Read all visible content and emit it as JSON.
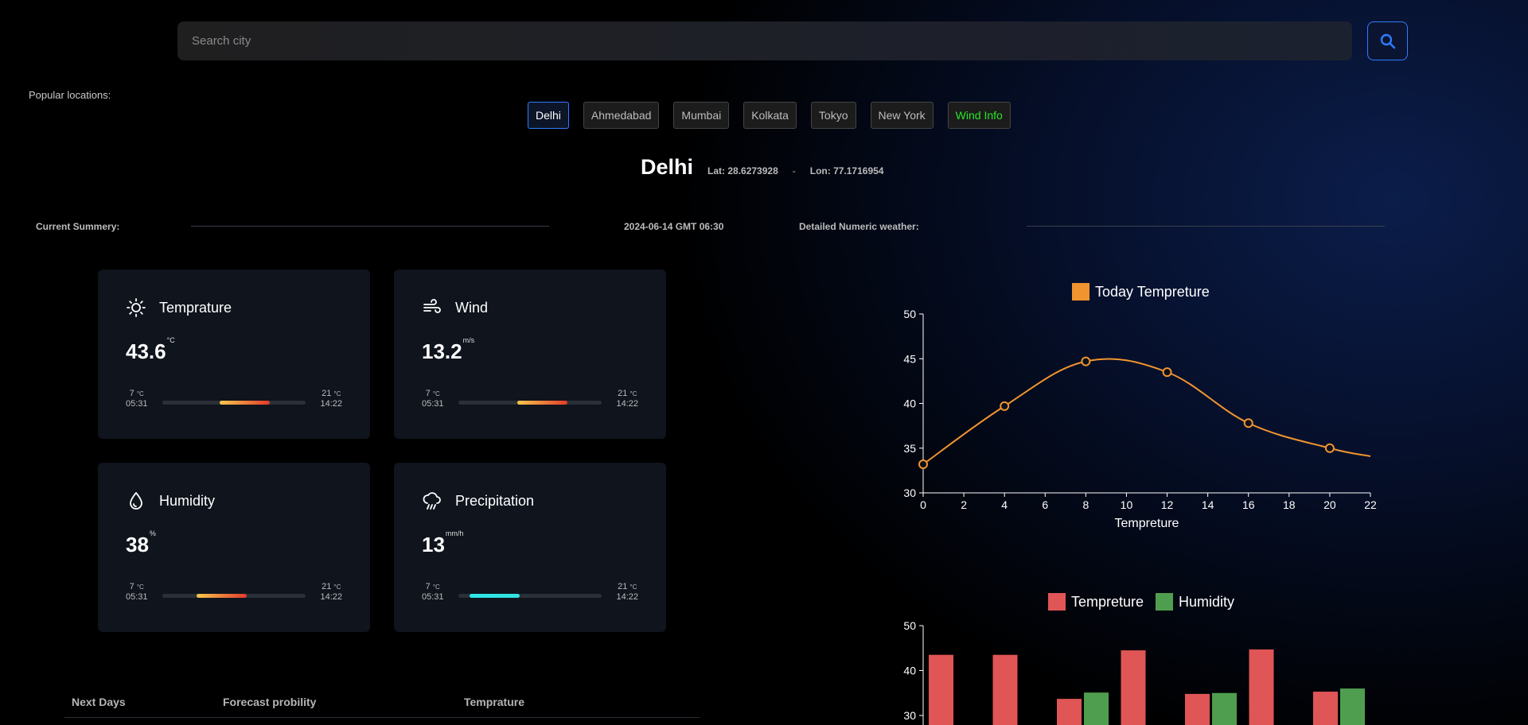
{
  "search": {
    "placeholder": "Search city"
  },
  "popular": {
    "label": "Popular locations:",
    "locations": [
      "Delhi",
      "Ahmedabad",
      "Mumbai",
      "Kolkata",
      "Tokyo",
      "New York",
      "Wind Info"
    ]
  },
  "city": {
    "name": "Delhi",
    "lat": "Lat: 28.6273928",
    "sep": "-",
    "lon": "Lon: 77.1716954"
  },
  "summary": {
    "current_label": "Current Summery:",
    "datetime": "2024-06-14 GMT 06:30",
    "detailed_label": "Detailed Numeric weather:"
  },
  "cards": [
    {
      "title": "Temprature",
      "value": "43.6",
      "unit": "°C",
      "lo": "7",
      "lo_unit": "°C",
      "lo_time": "05:31",
      "hi": "21",
      "hi_unit": "°C",
      "hi_time": "14:22",
      "icon": "sun-icon"
    },
    {
      "title": "Wind",
      "value": "13.2",
      "unit": "m/s",
      "lo": "7",
      "lo_unit": "°C",
      "lo_time": "05:31",
      "hi": "21",
      "hi_unit": "°C",
      "hi_time": "14:22",
      "icon": "wind-icon"
    },
    {
      "title": "Humidity",
      "value": "38",
      "unit": "%",
      "lo": "7",
      "lo_unit": "°C",
      "lo_time": "05:31",
      "hi": "21",
      "hi_unit": "°C",
      "hi_time": "14:22",
      "icon": "droplet-icon"
    },
    {
      "title": "Precipitation",
      "value": "13",
      "unit": "mm/h",
      "lo": "7",
      "lo_unit": "°C",
      "lo_time": "05:31",
      "hi": "21",
      "hi_unit": "°C",
      "hi_time": "14:22",
      "icon": "rain-cloud-icon"
    }
  ],
  "card_bar_levels": [
    {
      "start": 0.4,
      "end": 0.75,
      "gradient": [
        "#f5c84c",
        "#e23a2a"
      ]
    },
    {
      "start": 0.41,
      "end": 0.76,
      "gradient": [
        "#f5c84c",
        "#e23a2a"
      ]
    },
    {
      "start": 0.24,
      "end": 0.59,
      "gradient": [
        "#f5c84c",
        "#e23a2a"
      ]
    },
    {
      "start": 0.08,
      "end": 0.43,
      "gradient": [
        "#2ee6e6",
        "#33e0e0"
      ]
    }
  ],
  "next_days": {
    "headers": [
      "Next Days",
      "Forecast probility",
      "Temprature"
    ]
  },
  "colors": {
    "accent": "#2f7bff",
    "line": "#f0942f",
    "temp_bar": "#e05556",
    "humidity_bar": "#4f9e4f",
    "active_green": "#27e627"
  },
  "chart_data": [
    {
      "type": "line",
      "legend": [
        "Today Tempreture"
      ],
      "xlabel": "Tempreture",
      "ylabel": "",
      "x": [
        0,
        4,
        8,
        12,
        16,
        20
      ],
      "values": [
        33.2,
        39.7,
        44.7,
        43.5,
        37.8,
        35.0
      ],
      "end_value": 34.1,
      "xlim": [
        0,
        22
      ],
      "ylim": [
        30,
        50
      ],
      "xticks": [
        0,
        2,
        4,
        6,
        8,
        10,
        12,
        14,
        16,
        18,
        20,
        22
      ],
      "yticks": [
        30,
        35,
        40,
        45,
        50
      ]
    },
    {
      "type": "bar",
      "legend": [
        "Tempreture",
        "Humidity"
      ],
      "yticks": [
        30,
        40,
        50
      ],
      "ylim": [
        20,
        50
      ],
      "series": [
        {
          "name": "Tempreture",
          "values": [
            43.5,
            43.5,
            33.7,
            44.5,
            34.8,
            44.7,
            35.3
          ]
        },
        {
          "name": "Humidity",
          "values": [
            null,
            null,
            35.1,
            null,
            35.0,
            null,
            36.0
          ]
        }
      ]
    }
  ]
}
